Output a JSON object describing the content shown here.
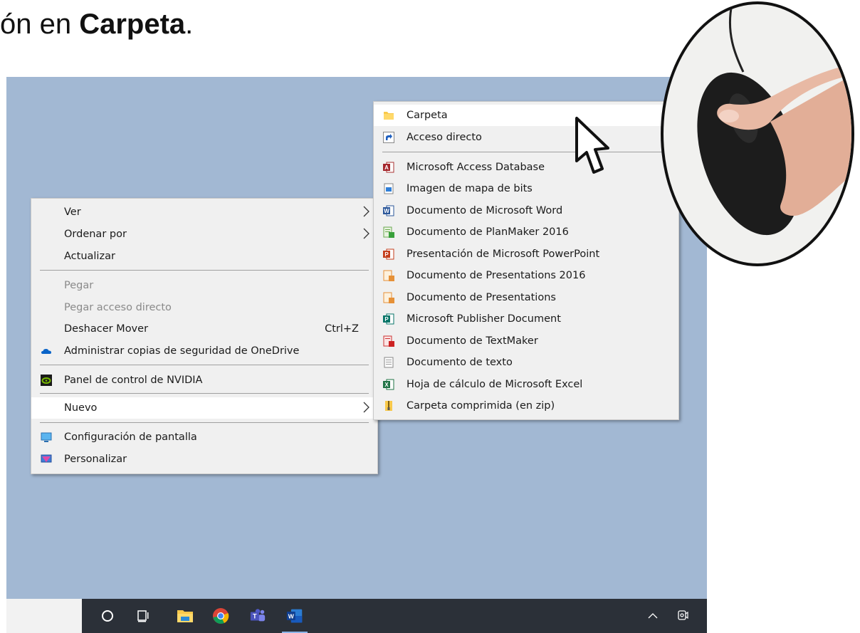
{
  "instruction": {
    "prefix": "ón en ",
    "bold": "Carpeta",
    "suffix": "."
  },
  "context_menu": {
    "items": [
      {
        "label": "Ver"
      },
      {
        "label": "Ordenar por"
      },
      {
        "label": "Actualizar"
      },
      {
        "label": "Pegar"
      },
      {
        "label": "Pegar acceso directo"
      },
      {
        "label": "Deshacer Mover",
        "shortcut": "Ctrl+Z"
      },
      {
        "label": "Administrar copias de seguridad de OneDrive"
      },
      {
        "label": "Panel de control de NVIDIA"
      },
      {
        "label": "Nuevo"
      },
      {
        "label": "Configuración de pantalla"
      },
      {
        "label": "Personalizar"
      }
    ]
  },
  "submenu_nuevo": {
    "items": [
      {
        "label": "Carpeta",
        "icon": "folder-icon"
      },
      {
        "label": "Acceso directo",
        "icon": "shortcut-icon"
      },
      {
        "label": "Microsoft Access Database",
        "icon": "access-icon"
      },
      {
        "label": "Imagen de mapa de bits",
        "icon": "bitmap-icon"
      },
      {
        "label": "Documento de Microsoft Word",
        "icon": "word-icon"
      },
      {
        "label": "Documento de PlanMaker 2016",
        "icon": "planmaker-icon"
      },
      {
        "label": "Presentación de Microsoft PowerPoint",
        "icon": "powerpoint-icon"
      },
      {
        "label": "Documento de Presentations 2016",
        "icon": "presentations-icon"
      },
      {
        "label": "Documento de Presentations",
        "icon": "presentations-icon"
      },
      {
        "label": "Microsoft Publisher Document",
        "icon": "publisher-icon"
      },
      {
        "label": "Documento de TextMaker",
        "icon": "textmaker-icon"
      },
      {
        "label": "Documento de texto",
        "icon": "text-document-icon"
      },
      {
        "label": "Hoja de cálculo de Microsoft Excel",
        "icon": "excel-icon"
      },
      {
        "label": "Carpeta comprimida (en zip)",
        "icon": "zip-folder-icon"
      }
    ]
  },
  "colors": {
    "desktop": "#a2b8d3",
    "taskbar": "#2b3038",
    "menu": "#f0f0f0",
    "highlight": "#ffffff"
  }
}
